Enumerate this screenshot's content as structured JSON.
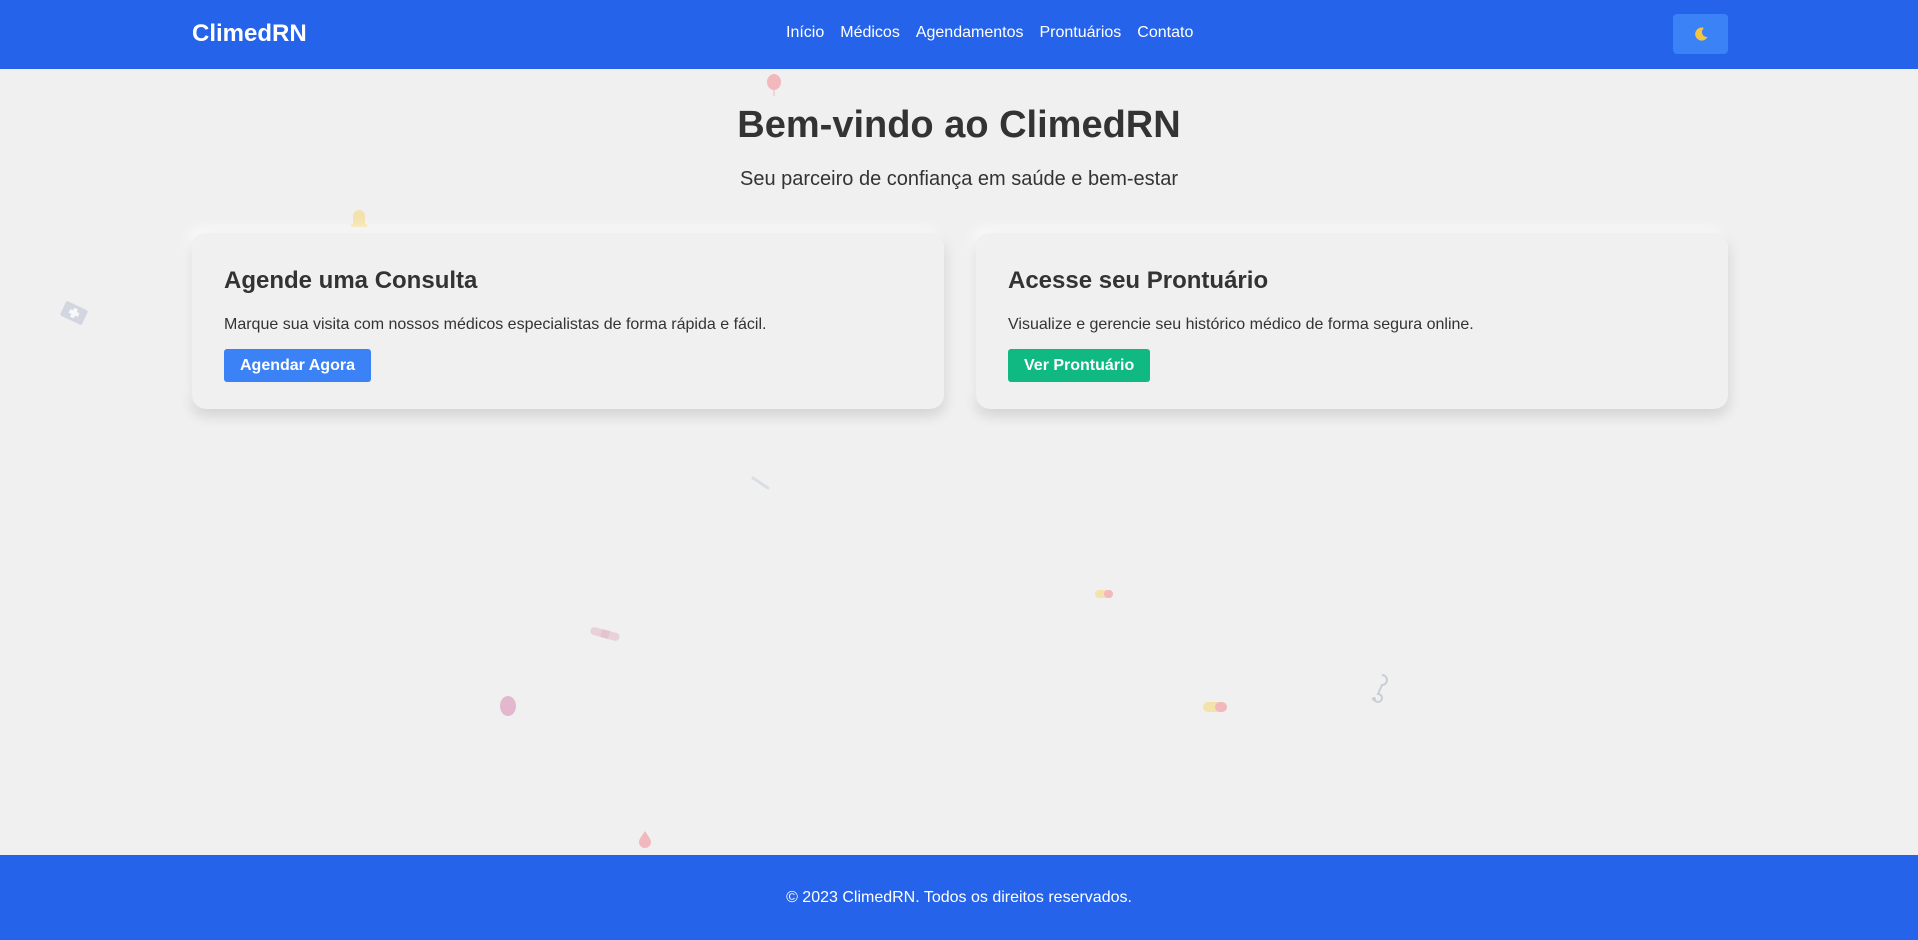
{
  "header": {
    "brand": "ClimedRN",
    "nav": [
      {
        "label": "Início"
      },
      {
        "label": "Médicos"
      },
      {
        "label": "Agendamentos"
      },
      {
        "label": "Prontuários"
      },
      {
        "label": "Contato"
      }
    ],
    "theme_toggle_icon": "moon-icon"
  },
  "hero": {
    "title": "Bem-vindo ao ClimedRN",
    "subtitle": "Seu parceiro de confiança em saúde e bem-estar"
  },
  "cards": [
    {
      "title": "Agende uma Consulta",
      "text": "Marque sua visita com nossos médicos especialistas de forma rápida e fácil.",
      "button": "Agendar Agora",
      "button_color": "#3b82f6"
    },
    {
      "title": "Acesse seu Prontuário",
      "text": "Visualize e gerencie seu histórico médico de forma segura online.",
      "button": "Ver Prontuário",
      "button_color": "#10b981"
    }
  ],
  "footer": {
    "text": "© 2023 ClimedRN. Todos os direitos reservados."
  },
  "colors": {
    "primary": "#2563eb",
    "accent_blue": "#3b82f6",
    "accent_green": "#10b981",
    "background": "#f0f0f0",
    "text": "#333333"
  }
}
